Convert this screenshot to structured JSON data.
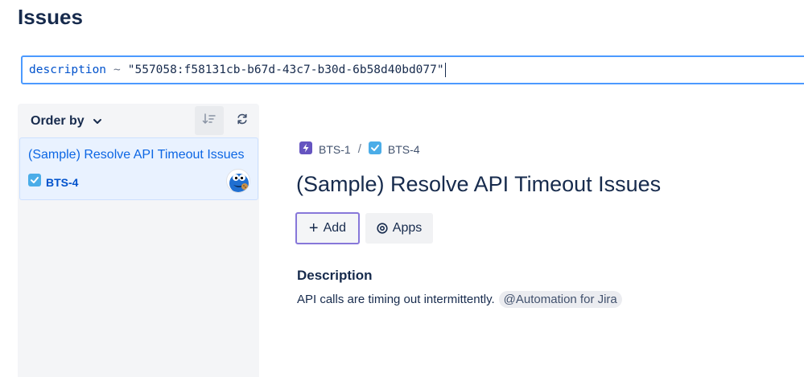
{
  "page": {
    "title": "Issues"
  },
  "search": {
    "field": "description",
    "operator": "~",
    "value": "\"557058:f58131cb-b67d-43c7-b30d-6b58d40bd077\""
  },
  "list": {
    "order_by_label": "Order by",
    "sort_icon": "sort-descending-icon",
    "refresh_icon": "refresh-icon",
    "items": [
      {
        "title": "(Sample) Resolve API Timeout Issues",
        "key": "BTS-4",
        "type_icon": "task-checkbox-icon",
        "avatar": "cookie-monster-avatar"
      }
    ]
  },
  "issue": {
    "breadcrumb": [
      {
        "key": "BTS-1",
        "icon": "epic-lightning-icon",
        "color": "#6554c0"
      },
      {
        "key": "BTS-4",
        "icon": "task-checkbox-icon",
        "color": "#4bade8"
      }
    ],
    "title": "(Sample) Resolve API Timeout Issues",
    "actions": {
      "add_label": "Add",
      "apps_label": "Apps"
    },
    "description": {
      "heading": "Description",
      "text": "API calls are timing out intermittently.",
      "mention": "@Automation for Jira"
    }
  },
  "colors": {
    "accent": "#4c9aff",
    "link": "#0c66e4",
    "add_border": "#8777d9"
  }
}
